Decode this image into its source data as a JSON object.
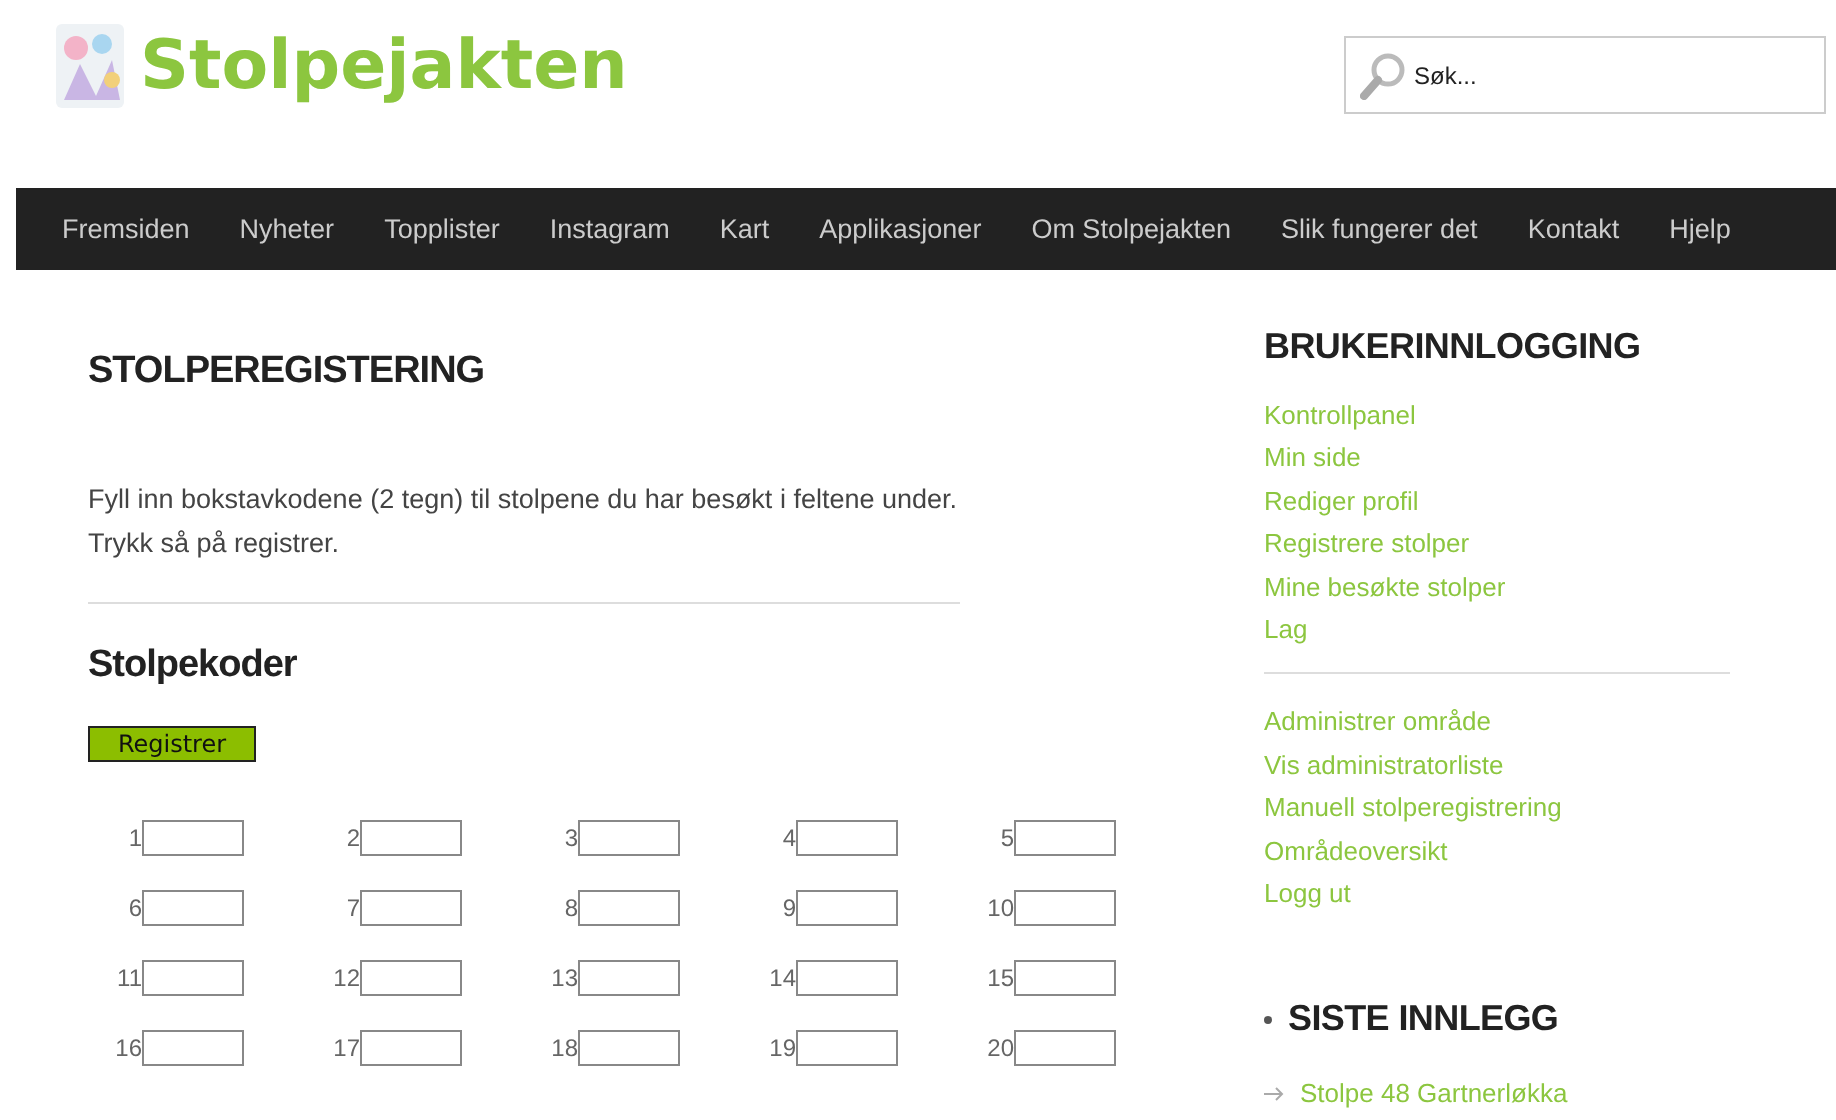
{
  "header": {
    "logo_text": "Stolpejakten",
    "search": {
      "placeholder": "Søk..."
    }
  },
  "nav": [
    "Fremsiden",
    "Nyheter",
    "Topplister",
    "Instagram",
    "Kart",
    "Applikasjoner",
    "Om Stolpejakten",
    "Slik fungerer det",
    "Kontakt",
    "Hjelp"
  ],
  "main": {
    "title": "STOLPEREGISTERING",
    "intro": [
      "Fyll inn bokstavkodene (2 tegn) til stolpene du har besøkt i feltene under.",
      "Trykk så på registrer."
    ],
    "section_title": "Stolpekoder",
    "submit_button": "Registrer",
    "code_fields": [
      "1",
      "2",
      "3",
      "4",
      "5",
      "6",
      "7",
      "8",
      "9",
      "10",
      "11",
      "12",
      "13",
      "14",
      "15",
      "16",
      "17",
      "18",
      "19",
      "20"
    ]
  },
  "sidebar": {
    "login_title": "BRUKERINNLOGGING",
    "user_links": [
      "Kontrollpanel",
      "Min side",
      "Rediger profil",
      "Registrere stolper",
      "Mine besøkte stolper",
      "Lag"
    ],
    "admin_links": [
      "Administrer område",
      "Vis administratorliste",
      "Manuell stolperegistrering",
      "Områdeoversikt",
      "Logg ut"
    ],
    "recent_title": "SISTE INNLEGG",
    "recent_posts": [
      "Stolpe 48 Gartnerløkka"
    ]
  }
}
